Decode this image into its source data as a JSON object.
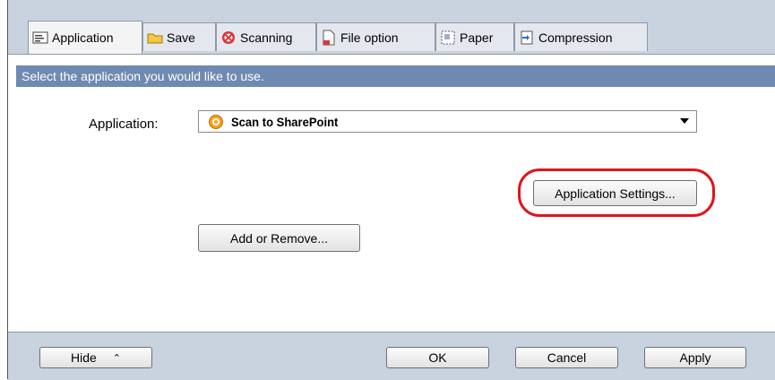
{
  "tabs": [
    {
      "label": "Application",
      "icon": "application-tab-icon",
      "active": true
    },
    {
      "label": "Save",
      "icon": "folder-icon"
    },
    {
      "label": "Scanning",
      "icon": "scanning-icon"
    },
    {
      "label": "File option",
      "icon": "file-option-icon"
    },
    {
      "label": "Paper",
      "icon": "paper-icon"
    },
    {
      "label": "Compression",
      "icon": "compression-icon"
    }
  ],
  "instruction": "Select the application you would like to use.",
  "application": {
    "label": "Application:",
    "selected_value": "Scan to SharePoint",
    "icon": "sharepoint-app-icon"
  },
  "buttons": {
    "application_settings": "Application Settings...",
    "add_or_remove": "Add or Remove...",
    "hide": "Hide",
    "ok": "OK",
    "cancel": "Cancel",
    "apply": "Apply"
  },
  "colors": {
    "instruction_bar": "#6f8ab2",
    "highlight": "#e0141c",
    "tabstrip": "#c9d2df"
  }
}
